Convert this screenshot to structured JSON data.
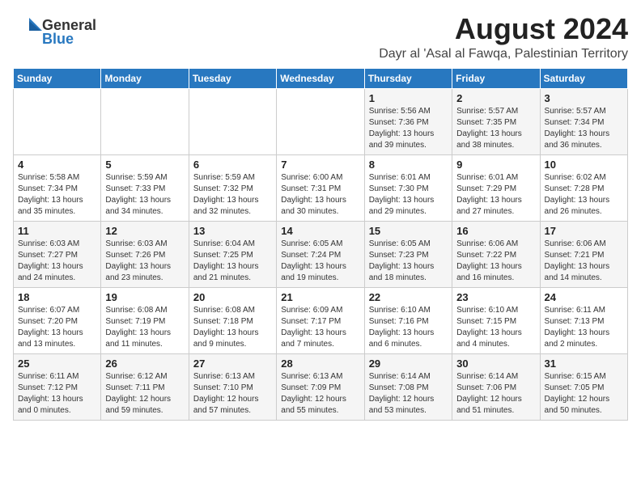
{
  "header": {
    "logo_general": "General",
    "logo_blue": "Blue",
    "month_year": "August 2024",
    "location": "Dayr al 'Asal al Fawqa, Palestinian Territory"
  },
  "weekdays": [
    "Sunday",
    "Monday",
    "Tuesday",
    "Wednesday",
    "Thursday",
    "Friday",
    "Saturday"
  ],
  "weeks": [
    {
      "row_class": "row-1",
      "days": [
        {
          "num": "",
          "info": ""
        },
        {
          "num": "",
          "info": ""
        },
        {
          "num": "",
          "info": ""
        },
        {
          "num": "",
          "info": ""
        },
        {
          "num": "1",
          "info": "Sunrise: 5:56 AM\nSunset: 7:36 PM\nDaylight: 13 hours\nand 39 minutes."
        },
        {
          "num": "2",
          "info": "Sunrise: 5:57 AM\nSunset: 7:35 PM\nDaylight: 13 hours\nand 38 minutes."
        },
        {
          "num": "3",
          "info": "Sunrise: 5:57 AM\nSunset: 7:34 PM\nDaylight: 13 hours\nand 36 minutes."
        }
      ]
    },
    {
      "row_class": "row-2",
      "days": [
        {
          "num": "4",
          "info": "Sunrise: 5:58 AM\nSunset: 7:34 PM\nDaylight: 13 hours\nand 35 minutes."
        },
        {
          "num": "5",
          "info": "Sunrise: 5:59 AM\nSunset: 7:33 PM\nDaylight: 13 hours\nand 34 minutes."
        },
        {
          "num": "6",
          "info": "Sunrise: 5:59 AM\nSunset: 7:32 PM\nDaylight: 13 hours\nand 32 minutes."
        },
        {
          "num": "7",
          "info": "Sunrise: 6:00 AM\nSunset: 7:31 PM\nDaylight: 13 hours\nand 30 minutes."
        },
        {
          "num": "8",
          "info": "Sunrise: 6:01 AM\nSunset: 7:30 PM\nDaylight: 13 hours\nand 29 minutes."
        },
        {
          "num": "9",
          "info": "Sunrise: 6:01 AM\nSunset: 7:29 PM\nDaylight: 13 hours\nand 27 minutes."
        },
        {
          "num": "10",
          "info": "Sunrise: 6:02 AM\nSunset: 7:28 PM\nDaylight: 13 hours\nand 26 minutes."
        }
      ]
    },
    {
      "row_class": "row-3",
      "days": [
        {
          "num": "11",
          "info": "Sunrise: 6:03 AM\nSunset: 7:27 PM\nDaylight: 13 hours\nand 24 minutes."
        },
        {
          "num": "12",
          "info": "Sunrise: 6:03 AM\nSunset: 7:26 PM\nDaylight: 13 hours\nand 23 minutes."
        },
        {
          "num": "13",
          "info": "Sunrise: 6:04 AM\nSunset: 7:25 PM\nDaylight: 13 hours\nand 21 minutes."
        },
        {
          "num": "14",
          "info": "Sunrise: 6:05 AM\nSunset: 7:24 PM\nDaylight: 13 hours\nand 19 minutes."
        },
        {
          "num": "15",
          "info": "Sunrise: 6:05 AM\nSunset: 7:23 PM\nDaylight: 13 hours\nand 18 minutes."
        },
        {
          "num": "16",
          "info": "Sunrise: 6:06 AM\nSunset: 7:22 PM\nDaylight: 13 hours\nand 16 minutes."
        },
        {
          "num": "17",
          "info": "Sunrise: 6:06 AM\nSunset: 7:21 PM\nDaylight: 13 hours\nand 14 minutes."
        }
      ]
    },
    {
      "row_class": "row-4",
      "days": [
        {
          "num": "18",
          "info": "Sunrise: 6:07 AM\nSunset: 7:20 PM\nDaylight: 13 hours\nand 13 minutes."
        },
        {
          "num": "19",
          "info": "Sunrise: 6:08 AM\nSunset: 7:19 PM\nDaylight: 13 hours\nand 11 minutes."
        },
        {
          "num": "20",
          "info": "Sunrise: 6:08 AM\nSunset: 7:18 PM\nDaylight: 13 hours\nand 9 minutes."
        },
        {
          "num": "21",
          "info": "Sunrise: 6:09 AM\nSunset: 7:17 PM\nDaylight: 13 hours\nand 7 minutes."
        },
        {
          "num": "22",
          "info": "Sunrise: 6:10 AM\nSunset: 7:16 PM\nDaylight: 13 hours\nand 6 minutes."
        },
        {
          "num": "23",
          "info": "Sunrise: 6:10 AM\nSunset: 7:15 PM\nDaylight: 13 hours\nand 4 minutes."
        },
        {
          "num": "24",
          "info": "Sunrise: 6:11 AM\nSunset: 7:13 PM\nDaylight: 13 hours\nand 2 minutes."
        }
      ]
    },
    {
      "row_class": "row-5",
      "days": [
        {
          "num": "25",
          "info": "Sunrise: 6:11 AM\nSunset: 7:12 PM\nDaylight: 13 hours\nand 0 minutes."
        },
        {
          "num": "26",
          "info": "Sunrise: 6:12 AM\nSunset: 7:11 PM\nDaylight: 12 hours\nand 59 minutes."
        },
        {
          "num": "27",
          "info": "Sunrise: 6:13 AM\nSunset: 7:10 PM\nDaylight: 12 hours\nand 57 minutes."
        },
        {
          "num": "28",
          "info": "Sunrise: 6:13 AM\nSunset: 7:09 PM\nDaylight: 12 hours\nand 55 minutes."
        },
        {
          "num": "29",
          "info": "Sunrise: 6:14 AM\nSunset: 7:08 PM\nDaylight: 12 hours\nand 53 minutes."
        },
        {
          "num": "30",
          "info": "Sunrise: 6:14 AM\nSunset: 7:06 PM\nDaylight: 12 hours\nand 51 minutes."
        },
        {
          "num": "31",
          "info": "Sunrise: 6:15 AM\nSunset: 7:05 PM\nDaylight: 12 hours\nand 50 minutes."
        }
      ]
    }
  ]
}
